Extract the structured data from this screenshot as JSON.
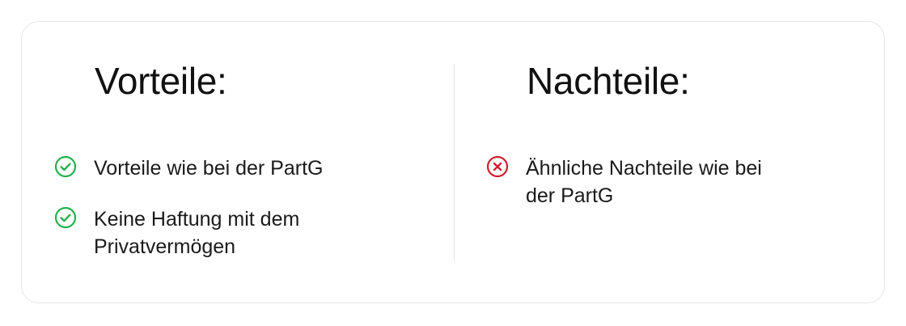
{
  "pros": {
    "title": "Vorteile:",
    "items": [
      {
        "text": "Vorteile wie bei der PartG",
        "icon": "check-circle-icon"
      },
      {
        "text": "Keine Haftung mit dem Privatvermögen",
        "icon": "check-circle-icon"
      }
    ]
  },
  "cons": {
    "title": "Nachteile:",
    "items": [
      {
        "text": "Ähnliche Nachteile wie bei der PartG",
        "icon": "x-circle-icon"
      }
    ]
  },
  "colors": {
    "positive": "#22b14c",
    "negative": "#d11f2d",
    "border": "#e6e6e6"
  }
}
